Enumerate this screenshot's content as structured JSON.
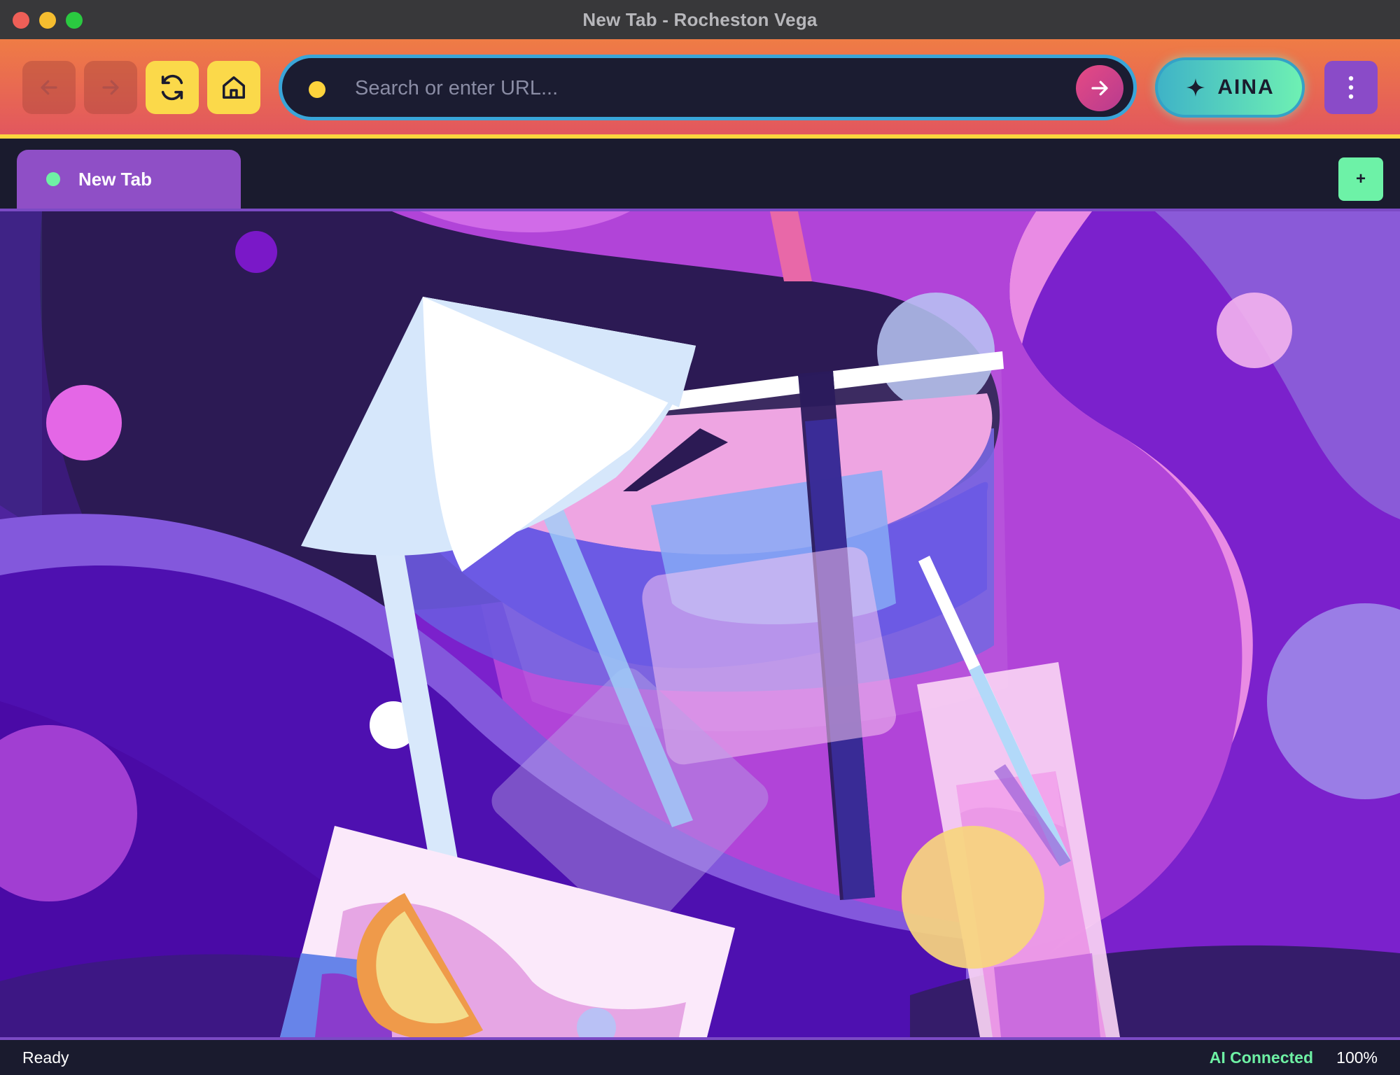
{
  "window": {
    "title": "New Tab - Rocheston Vega"
  },
  "toolbar": {
    "back_icon": "arrow-left-icon",
    "forward_icon": "arrow-right-icon",
    "reload_icon": "reload-icon",
    "home_icon": "home-icon",
    "url": {
      "value": "",
      "placeholder": "Search or enter URL..."
    },
    "go_icon": "arrow-right-icon",
    "ai_button_label": "AINA",
    "ai_icon": "sparkle-icon",
    "menu_icon": "kebab-menu-icon"
  },
  "tabs": [
    {
      "label": "New Tab",
      "active": true
    }
  ],
  "new_tab_label": "+",
  "status": {
    "left": "Ready",
    "ai": "AI Connected",
    "zoom": "100%"
  },
  "colors": {
    "toolbar_gradient_start": "#ef7c45",
    "toolbar_gradient_end": "#e2575e",
    "accent_yellow": "#fbd94a",
    "url_border": "#3aa5d8",
    "tab_active": "#8f4fc6",
    "ai_green": "#6ef0a4",
    "window_dark": "#1a1b2e"
  }
}
